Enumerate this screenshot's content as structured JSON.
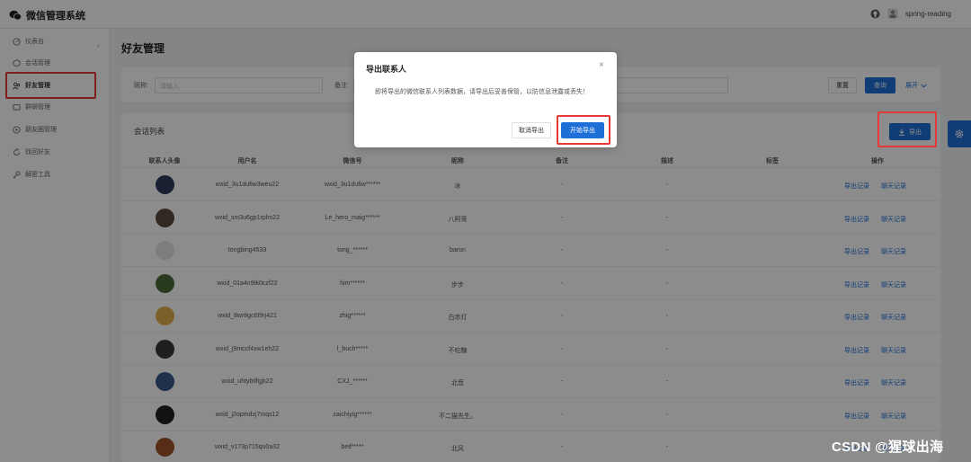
{
  "app": {
    "title": "微信管理系统",
    "user": "spring-reading"
  },
  "sidebar": {
    "collapse_glyph": "‹",
    "items": [
      {
        "label": "仪表台",
        "icon": "dashboard-icon"
      },
      {
        "label": "会话管理",
        "icon": "chat-icon"
      },
      {
        "label": "好友管理",
        "icon": "friends-icon",
        "active": true
      },
      {
        "label": "群聊管理",
        "icon": "group-icon"
      },
      {
        "label": "朋友圈管理",
        "icon": "moments-icon"
      },
      {
        "label": "找回好友",
        "icon": "recover-icon"
      },
      {
        "label": "解密工具",
        "icon": "key-icon"
      }
    ]
  },
  "page": {
    "title": "好友管理"
  },
  "filters": {
    "nickname_label": "昵称:",
    "nickname_placeholder": "请输入",
    "remark_label": "备注:",
    "reset_label": "重置",
    "query_label": "查询",
    "expand_label": "展开"
  },
  "list": {
    "title": "会话列表",
    "export_label": "导出",
    "columns": [
      "联系人头像",
      "用户名",
      "微信号",
      "昵称",
      "备注",
      "描述",
      "标签",
      "操作"
    ],
    "rows": [
      {
        "username": "wxid_3u1dufiw3weu22",
        "wechat_id": "wxid_3u1dufiw******",
        "nickname": "冰",
        "remark": "-",
        "desc": "-",
        "avatar_color": "#2f3d5c"
      },
      {
        "username": "wxid_sm3u6gp1rplm22",
        "wechat_id": "Le_hero_maig******",
        "nickname": "八阿哥",
        "remark": "-",
        "desc": "-",
        "avatar_color": "#5a4a3f"
      },
      {
        "username": "tongbing4533",
        "wechat_id": "tong_******",
        "nickname": "baron",
        "remark": "-",
        "desc": "-",
        "avatar_color": "#e4e4e4"
      },
      {
        "username": "wxid_01a4n9tk0czf22",
        "wechat_id": "him******",
        "nickname": "步步",
        "remark": "-",
        "desc": "-",
        "avatar_color": "#4d6b3a"
      },
      {
        "username": "wxid_8wr8gc6t9rj421",
        "wechat_id": "zhig******",
        "nickname": "白赤灯",
        "remark": "-",
        "desc": "-",
        "avatar_color": "#e3b04b"
      },
      {
        "username": "wxid_j9mccf4xw1eh22",
        "wechat_id": "l_buch*****",
        "nickname": "不吃糖",
        "remark": "-",
        "desc": "-",
        "avatar_color": "#3a3a3a"
      },
      {
        "username": "wxid_uhtybtlfgjk22",
        "wechat_id": "CXJ_******",
        "nickname": "北音",
        "remark": "-",
        "desc": "-",
        "avatar_color": "#3b5a8a"
      },
      {
        "username": "wxid_j2opmdzj7mqs12",
        "wechat_id": "zaichiyig******",
        "nickname": "不二猫先生。",
        "remark": "-",
        "desc": "-",
        "avatar_color": "#222222"
      },
      {
        "username": "wxid_v173p715qu0a32",
        "wechat_id": "beif*****",
        "nickname": "北风",
        "remark": "-",
        "desc": "-",
        "avatar_color": "#a0522d"
      }
    ],
    "action_export": "导出记录",
    "action_chat": "聊天记录"
  },
  "dialog": {
    "title": "导出联系人",
    "message": "即将导出的微信联系人列表数据，请导出后妥善保管，以防信息泄露或丢失！",
    "cancel_label": "取消导出",
    "confirm_label": "开始导出",
    "close_glyph": "×"
  },
  "watermark": "CSDN @猩球出海",
  "colors": {
    "primary": "#1f6fd8",
    "highlight": "#e53935",
    "overlay": "rgba(0,0,0,0.45)"
  }
}
